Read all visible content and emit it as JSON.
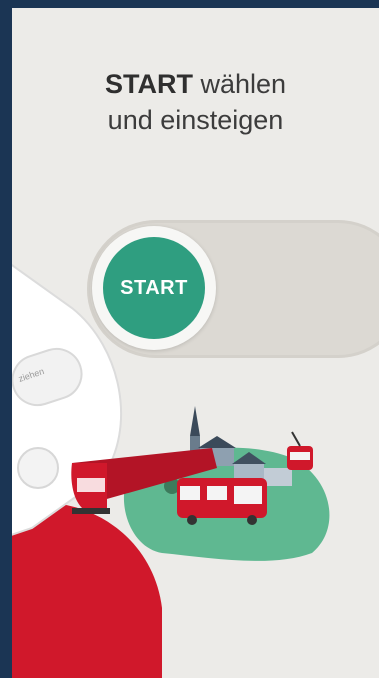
{
  "heading": {
    "bold": "START",
    "rest_line1": " wählen",
    "line2": "und einsteigen"
  },
  "slider": {
    "button_label": "START"
  },
  "phone": {
    "swipe_label": "ziehen"
  },
  "colors": {
    "outer_background": "#1b3554",
    "panel_background": "#ecebe8",
    "start_button": "#2f9e80",
    "accent_red": "#d0182b",
    "hill_green": "#5fb891"
  }
}
